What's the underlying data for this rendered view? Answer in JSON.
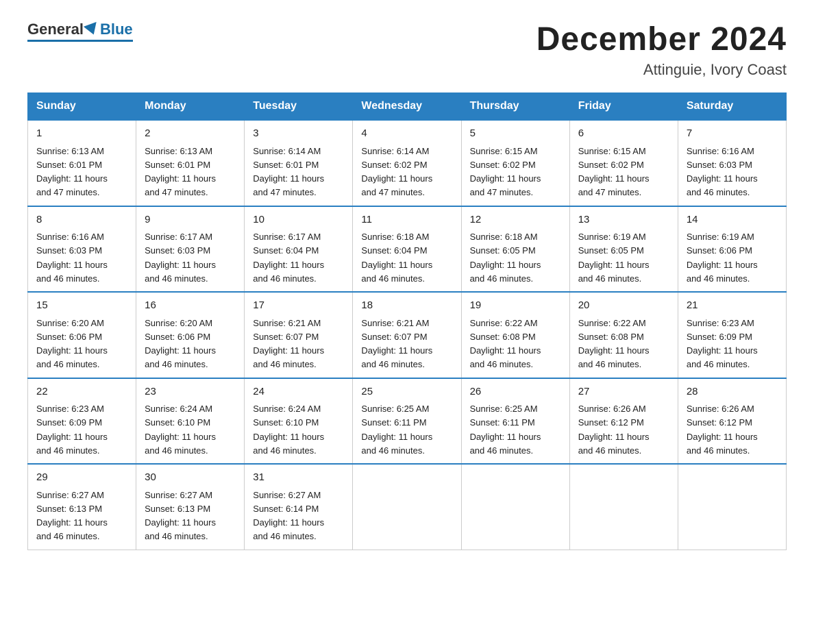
{
  "logo": {
    "general": "General",
    "blue": "Blue"
  },
  "header": {
    "month": "December 2024",
    "location": "Attinguie, Ivory Coast"
  },
  "weekdays": [
    "Sunday",
    "Monday",
    "Tuesday",
    "Wednesday",
    "Thursday",
    "Friday",
    "Saturday"
  ],
  "weeks": [
    [
      {
        "day": "1",
        "sunrise": "6:13 AM",
        "sunset": "6:01 PM",
        "daylight": "11 hours and 47 minutes."
      },
      {
        "day": "2",
        "sunrise": "6:13 AM",
        "sunset": "6:01 PM",
        "daylight": "11 hours and 47 minutes."
      },
      {
        "day": "3",
        "sunrise": "6:14 AM",
        "sunset": "6:01 PM",
        "daylight": "11 hours and 47 minutes."
      },
      {
        "day": "4",
        "sunrise": "6:14 AM",
        "sunset": "6:02 PM",
        "daylight": "11 hours and 47 minutes."
      },
      {
        "day": "5",
        "sunrise": "6:15 AM",
        "sunset": "6:02 PM",
        "daylight": "11 hours and 47 minutes."
      },
      {
        "day": "6",
        "sunrise": "6:15 AM",
        "sunset": "6:02 PM",
        "daylight": "11 hours and 47 minutes."
      },
      {
        "day": "7",
        "sunrise": "6:16 AM",
        "sunset": "6:03 PM",
        "daylight": "11 hours and 46 minutes."
      }
    ],
    [
      {
        "day": "8",
        "sunrise": "6:16 AM",
        "sunset": "6:03 PM",
        "daylight": "11 hours and 46 minutes."
      },
      {
        "day": "9",
        "sunrise": "6:17 AM",
        "sunset": "6:03 PM",
        "daylight": "11 hours and 46 minutes."
      },
      {
        "day": "10",
        "sunrise": "6:17 AM",
        "sunset": "6:04 PM",
        "daylight": "11 hours and 46 minutes."
      },
      {
        "day": "11",
        "sunrise": "6:18 AM",
        "sunset": "6:04 PM",
        "daylight": "11 hours and 46 minutes."
      },
      {
        "day": "12",
        "sunrise": "6:18 AM",
        "sunset": "6:05 PM",
        "daylight": "11 hours and 46 minutes."
      },
      {
        "day": "13",
        "sunrise": "6:19 AM",
        "sunset": "6:05 PM",
        "daylight": "11 hours and 46 minutes."
      },
      {
        "day": "14",
        "sunrise": "6:19 AM",
        "sunset": "6:06 PM",
        "daylight": "11 hours and 46 minutes."
      }
    ],
    [
      {
        "day": "15",
        "sunrise": "6:20 AM",
        "sunset": "6:06 PM",
        "daylight": "11 hours and 46 minutes."
      },
      {
        "day": "16",
        "sunrise": "6:20 AM",
        "sunset": "6:06 PM",
        "daylight": "11 hours and 46 minutes."
      },
      {
        "day": "17",
        "sunrise": "6:21 AM",
        "sunset": "6:07 PM",
        "daylight": "11 hours and 46 minutes."
      },
      {
        "day": "18",
        "sunrise": "6:21 AM",
        "sunset": "6:07 PM",
        "daylight": "11 hours and 46 minutes."
      },
      {
        "day": "19",
        "sunrise": "6:22 AM",
        "sunset": "6:08 PM",
        "daylight": "11 hours and 46 minutes."
      },
      {
        "day": "20",
        "sunrise": "6:22 AM",
        "sunset": "6:08 PM",
        "daylight": "11 hours and 46 minutes."
      },
      {
        "day": "21",
        "sunrise": "6:23 AM",
        "sunset": "6:09 PM",
        "daylight": "11 hours and 46 minutes."
      }
    ],
    [
      {
        "day": "22",
        "sunrise": "6:23 AM",
        "sunset": "6:09 PM",
        "daylight": "11 hours and 46 minutes."
      },
      {
        "day": "23",
        "sunrise": "6:24 AM",
        "sunset": "6:10 PM",
        "daylight": "11 hours and 46 minutes."
      },
      {
        "day": "24",
        "sunrise": "6:24 AM",
        "sunset": "6:10 PM",
        "daylight": "11 hours and 46 minutes."
      },
      {
        "day": "25",
        "sunrise": "6:25 AM",
        "sunset": "6:11 PM",
        "daylight": "11 hours and 46 minutes."
      },
      {
        "day": "26",
        "sunrise": "6:25 AM",
        "sunset": "6:11 PM",
        "daylight": "11 hours and 46 minutes."
      },
      {
        "day": "27",
        "sunrise": "6:26 AM",
        "sunset": "6:12 PM",
        "daylight": "11 hours and 46 minutes."
      },
      {
        "day": "28",
        "sunrise": "6:26 AM",
        "sunset": "6:12 PM",
        "daylight": "11 hours and 46 minutes."
      }
    ],
    [
      {
        "day": "29",
        "sunrise": "6:27 AM",
        "sunset": "6:13 PM",
        "daylight": "11 hours and 46 minutes."
      },
      {
        "day": "30",
        "sunrise": "6:27 AM",
        "sunset": "6:13 PM",
        "daylight": "11 hours and 46 minutes."
      },
      {
        "day": "31",
        "sunrise": "6:27 AM",
        "sunset": "6:14 PM",
        "daylight": "11 hours and 46 minutes."
      },
      null,
      null,
      null,
      null
    ]
  ],
  "labels": {
    "sunrise": "Sunrise:",
    "sunset": "Sunset:",
    "daylight": "Daylight:"
  }
}
